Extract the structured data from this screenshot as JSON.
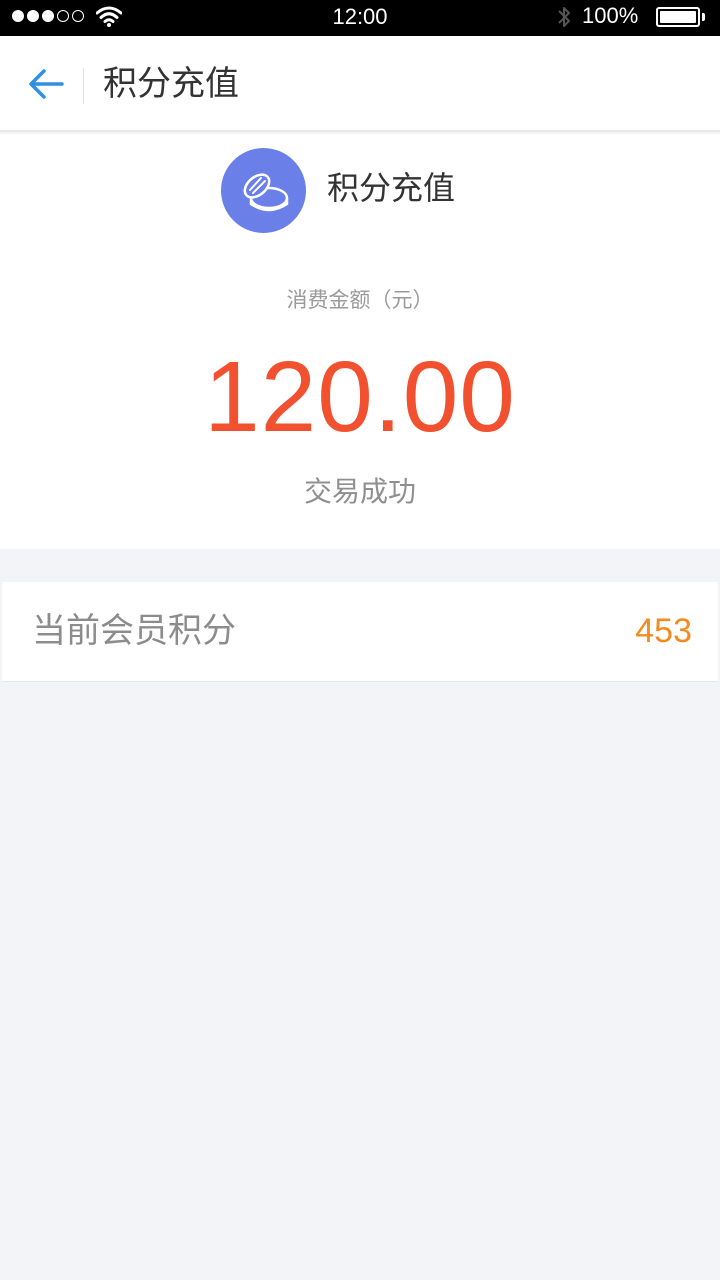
{
  "status_bar": {
    "time": "12:00",
    "battery": "100%",
    "signal_strength": 3,
    "signal_max": 5
  },
  "nav": {
    "title": "积分充值",
    "back_icon": "arrow-left-icon",
    "accent_color": "#2f8fe0"
  },
  "summary": {
    "icon": "coins-icon",
    "icon_bg_color": "#6a7fe8",
    "title": "积分充值",
    "amount_label": "消费金额（元）",
    "amount": "120.00",
    "amount_color": "#f2512f",
    "status": "交易成功"
  },
  "points": {
    "label": "当前会员积分",
    "value": "453",
    "value_color": "#f58a1f"
  }
}
